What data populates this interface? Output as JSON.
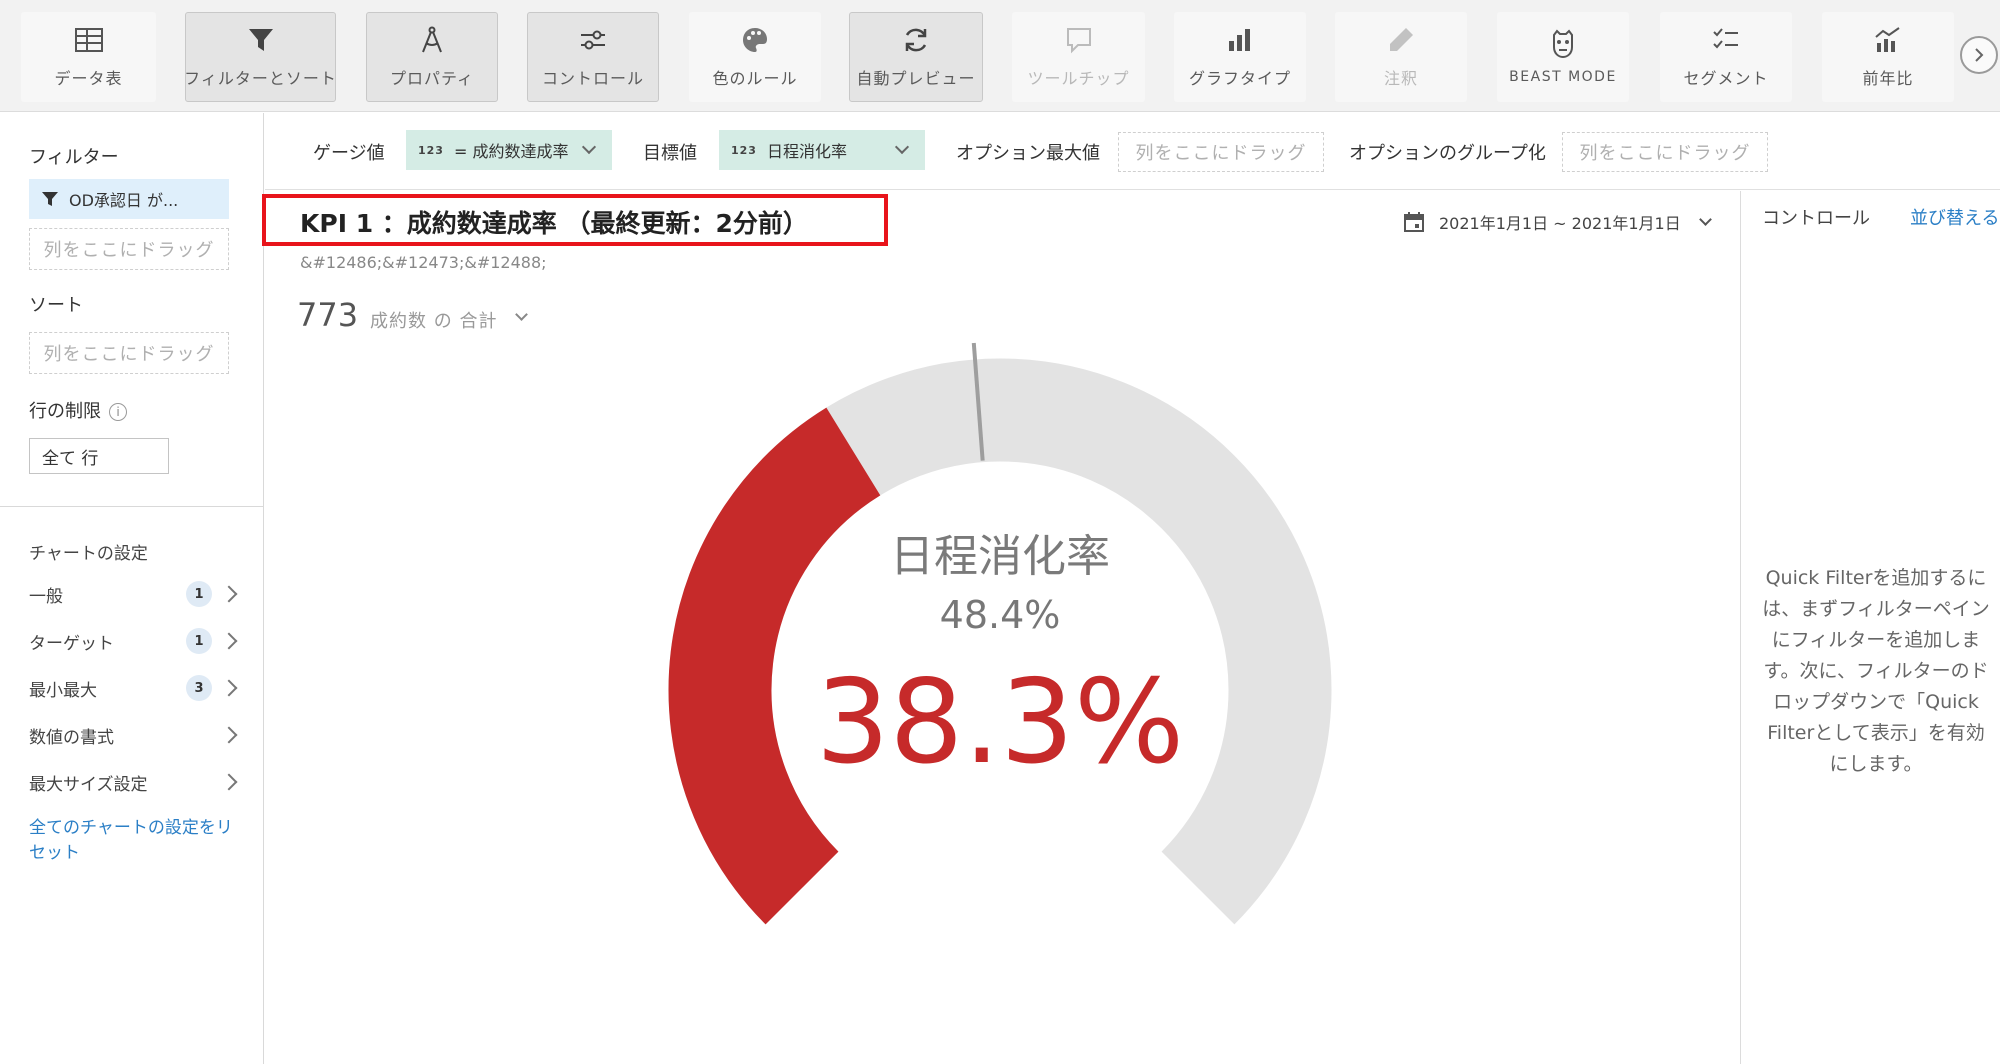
{
  "toolbar": {
    "data_table": "データ表",
    "filter_sort": "フィルターとソート",
    "properties": "プロパティ",
    "controls": "コントロール",
    "color_rules": "色のルール",
    "auto_preview": "自動プレビュー",
    "tooltip": "ツールチップ",
    "chart_type": "グラフタイプ",
    "annotation": "注釈",
    "beast_mode": "BEAST MODE",
    "segment": "セグメント",
    "yoy": "前年比"
  },
  "left": {
    "filter_heading": "フィルター",
    "filter_pill": "OD承認日 が...",
    "filter_drop": "列をここにドラッグ",
    "sort_heading": "ソート",
    "sort_drop": "列をここにドラッグ",
    "row_limit_heading": "行の制限",
    "row_limit_value": "全て 行",
    "chart_settings_heading": "チャートの設定",
    "settings": [
      {
        "label": "一般",
        "badge": "1"
      },
      {
        "label": "ターゲット",
        "badge": "1"
      },
      {
        "label": "最小最大",
        "badge": "3"
      },
      {
        "label": "数値の書式",
        "badge": ""
      },
      {
        "label": "最大サイズ設定",
        "badge": ""
      }
    ],
    "reset_link": "全てのチャートの設定をリセット"
  },
  "fieldbar": {
    "gauge_label": "ゲージ値",
    "gauge_pill": "= 成約数達成率",
    "gauge_num": "123",
    "target_label": "目標値",
    "target_pill": "日程消化率",
    "target_num": "123",
    "optmax_label": "オプション最大値",
    "optmax_drop": "列をここにドラッグ",
    "optgroup_label": "オプションのグループ化",
    "optgroup_drop": "列をここにドラッグ"
  },
  "main": {
    "title": "KPI 1 ：成約数達成率 （最終更新：2分前）",
    "subtitle": "&#12486;&#12473;&#12488;",
    "summary_value": "773",
    "summary_label": "成約数 の 合計",
    "date_range": "2021年1月1日 ~ 2021年1月1日"
  },
  "gauge": {
    "label": "日程消化率",
    "target_text": "48.4%",
    "value_text": "38.3%",
    "value": 0.383,
    "target": 0.484,
    "fill_color": "#c62a2a",
    "track_color": "#e3e3e3",
    "marker_color": "#9e9e9e"
  },
  "right": {
    "title": "コントロール",
    "sort_link": "並び替える",
    "help_text": "Quick Filterを追加するには、まずフィルターペインにフィルターを追加します。次に、フィルターのドロップダウンで「Quick Filterとして表示」を有効にします。"
  }
}
